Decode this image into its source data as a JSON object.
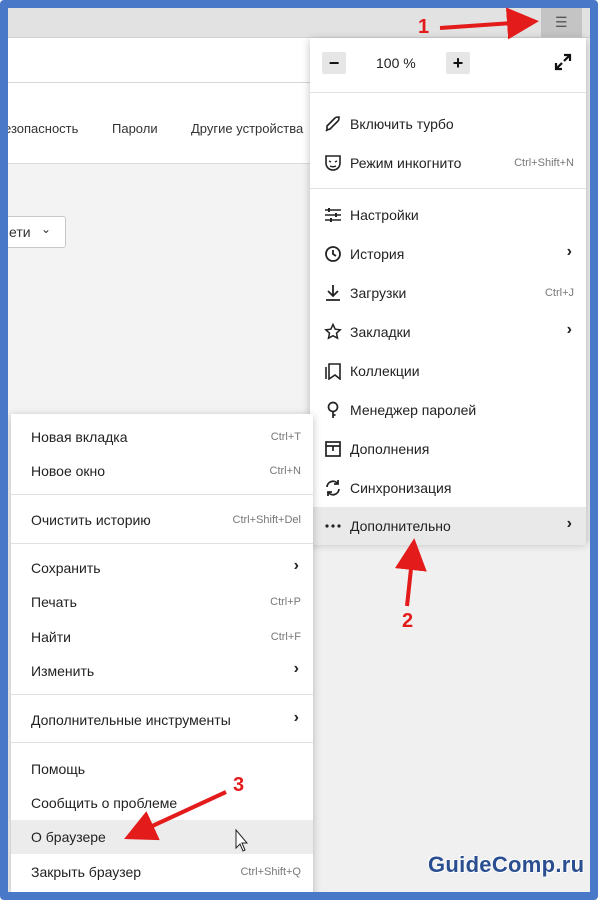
{
  "browser": {
    "menu_icon": "hamburger-icon",
    "settings_nav": [
      "езопасность",
      "Пароли",
      "Другие устройства"
    ],
    "dropdown_label": "ети",
    "dropdown_icon": "chevron-down-icon"
  },
  "main_menu": {
    "zoom": {
      "minus": "−",
      "value": "100 %",
      "plus": "+",
      "fullscreen_icon": "fullscreen-icon"
    },
    "items": [
      {
        "icon": "rocket-icon",
        "label": "Включить турбо",
        "shortcut": ""
      },
      {
        "icon": "incognito-mask-icon",
        "label": "Режим инкогнито",
        "shortcut": "Ctrl+Shift+N"
      },
      {
        "icon": "sliders-icon",
        "label": "Настройки",
        "shortcut": ""
      },
      {
        "icon": "clock-icon",
        "label": "История",
        "shortcut": "",
        "submenu": true
      },
      {
        "icon": "download-icon",
        "label": "Загрузки",
        "shortcut": "Ctrl+J"
      },
      {
        "icon": "star-icon",
        "label": "Закладки",
        "shortcut": "",
        "submenu": true
      },
      {
        "icon": "collections-icon",
        "label": "Коллекции",
        "shortcut": ""
      },
      {
        "icon": "key-icon",
        "label": "Менеджер паролей",
        "shortcut": ""
      },
      {
        "icon": "extensions-icon",
        "label": "Дополнения",
        "shortcut": ""
      },
      {
        "icon": "sync-icon",
        "label": "Синхронизация",
        "shortcut": ""
      },
      {
        "icon": "more-dots-icon",
        "label": "Дополнительно",
        "shortcut": "",
        "submenu": true
      }
    ]
  },
  "sub_menu": {
    "items": [
      {
        "label": "Новая вкладка",
        "shortcut": "Ctrl+T"
      },
      {
        "label": "Новое окно",
        "shortcut": "Ctrl+N"
      },
      {
        "label": "Очистить историю",
        "shortcut": "Ctrl+Shift+Del"
      },
      {
        "label": "Сохранить",
        "shortcut": "",
        "submenu": true
      },
      {
        "label": "Печать",
        "shortcut": "Ctrl+P"
      },
      {
        "label": "Найти",
        "shortcut": "Ctrl+F"
      },
      {
        "label": "Изменить",
        "shortcut": "",
        "submenu": true
      },
      {
        "label": "Дополнительные инструменты",
        "shortcut": "",
        "submenu": true
      },
      {
        "label": "Помощь",
        "shortcut": ""
      },
      {
        "label": "Сообщить о проблеме",
        "shortcut": ""
      },
      {
        "label": "О браузере",
        "shortcut": ""
      },
      {
        "label": "Закрыть браузер",
        "shortcut": "Ctrl+Shift+Q"
      }
    ]
  },
  "annotations": {
    "step1": "1",
    "step2": "2",
    "step3": "3",
    "arrow_color": "#e31b1b"
  },
  "watermark": "GuideComp.ru",
  "arrow_glyph": "›",
  "cursor_icon": "mouse-pointer-icon",
  "colors": {
    "frame": "#4a78c9",
    "highlight": "#e9e9e9",
    "watermark": "#2a4e8f"
  }
}
